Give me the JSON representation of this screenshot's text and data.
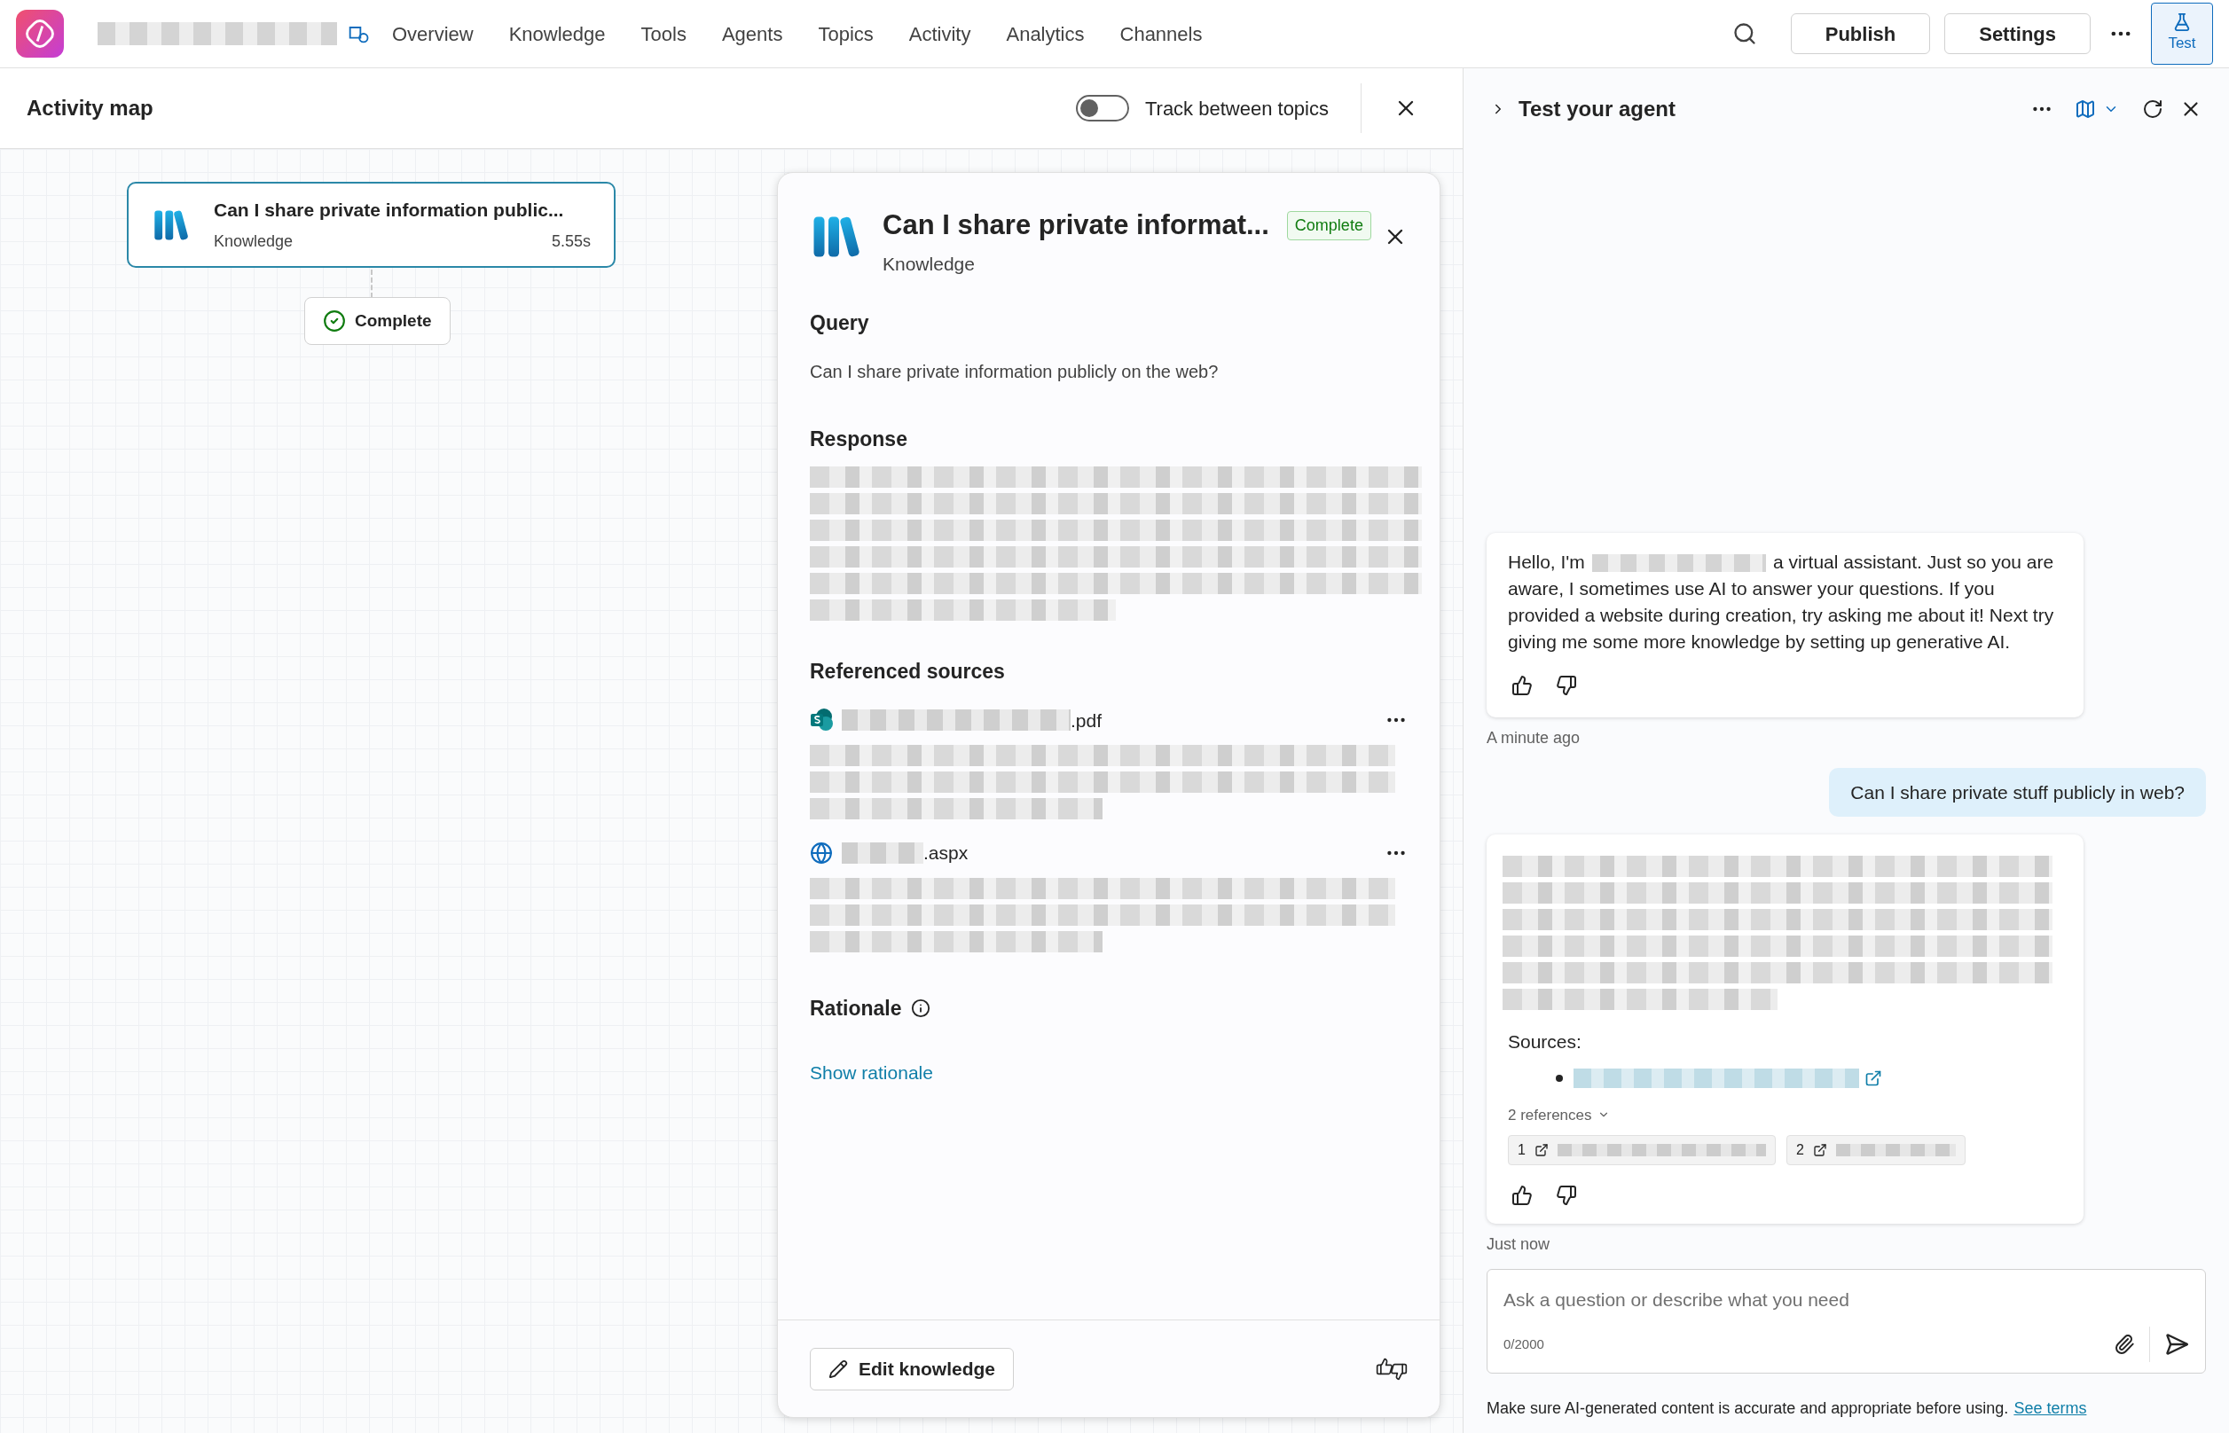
{
  "topbar": {
    "nav": [
      "Overview",
      "Knowledge",
      "Tools",
      "Agents",
      "Topics",
      "Activity",
      "Analytics",
      "Channels"
    ],
    "publish": "Publish",
    "settings": "Settings",
    "test": {
      "label": "Test",
      "selected": true
    }
  },
  "activity_map": {
    "title": "Activity map",
    "toggle": {
      "label": "Track between topics",
      "on": false
    },
    "node": {
      "title": "Can I share private information public...",
      "subtitle": "Knowledge",
      "duration": "5.55s"
    },
    "status": "Complete"
  },
  "details": {
    "title": "Can I share private informat...",
    "badge": "Complete",
    "subtitle": "Knowledge",
    "query_heading": "Query",
    "query": "Can I share private information publicly on the web?",
    "response_heading": "Response",
    "sources_heading": "Referenced sources",
    "sources": [
      {
        "kind": "sharepoint",
        "name": ".pdf"
      },
      {
        "kind": "web",
        "name": ".aspx"
      }
    ],
    "rationale_heading": "Rationale",
    "rationale_link": "Show rationale",
    "edit_button": "Edit knowledge"
  },
  "chat": {
    "title": "Test your agent",
    "messages": [
      {
        "kind": "bot",
        "greeting": "Hello, I'm",
        "text": "a virtual assistant. Just so you are aware, I sometimes use AI to answer your questions. If you provided a website during creation, try asking me about it! Next try giving me some more knowledge by setting up generative AI.",
        "time": "A minute ago"
      },
      {
        "kind": "user",
        "text": "Can I share private stuff publicly in web?"
      },
      {
        "kind": "answer",
        "sources_label": "Sources:",
        "references": "2 references",
        "chips": [
          "1",
          "2"
        ],
        "time": "Just now"
      }
    ],
    "input": {
      "placeholder": "Ask a question or describe what you need",
      "counter": "0/2000"
    },
    "disclaimer": "Make sure AI-generated content is accurate and appropriate before using.",
    "terms_link": "See terms"
  }
}
